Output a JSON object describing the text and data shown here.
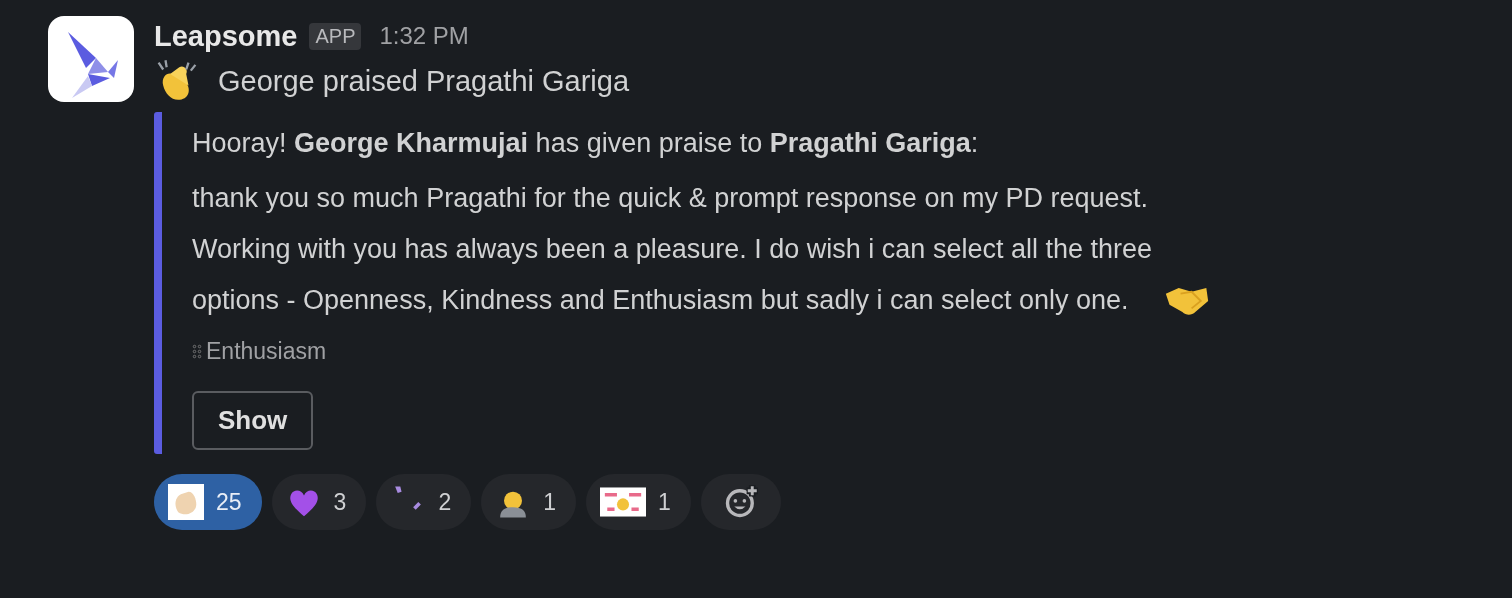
{
  "message": {
    "sender": "Leapsome",
    "badge": "APP",
    "time": "1:32 PM",
    "summary": "George praised Pragathi Gariga"
  },
  "attachment": {
    "headline": "Hooray! **George Kharmujai** has given praise to **Pragathi Gariga**:",
    "body_lines": [
      "thank you so much Pragathi for the quick & prompt response on my PD request.",
      "Working with you has always been a pleasure. I do wish i can select all the three",
      "options - Openness, Kindness and Enthusiasm but sadly i can select only one."
    ],
    "tag": "Enthusiasm",
    "button": "Show"
  },
  "reactions": [
    {
      "kind": "wave",
      "count": "25",
      "selected": true
    },
    {
      "kind": "heart",
      "count": "3",
      "selected": false
    },
    {
      "kind": "confetti",
      "count": "2",
      "selected": false
    },
    {
      "kind": "bow",
      "count": "1",
      "selected": false
    },
    {
      "kind": "thankyou",
      "count": "1",
      "selected": false
    }
  ]
}
